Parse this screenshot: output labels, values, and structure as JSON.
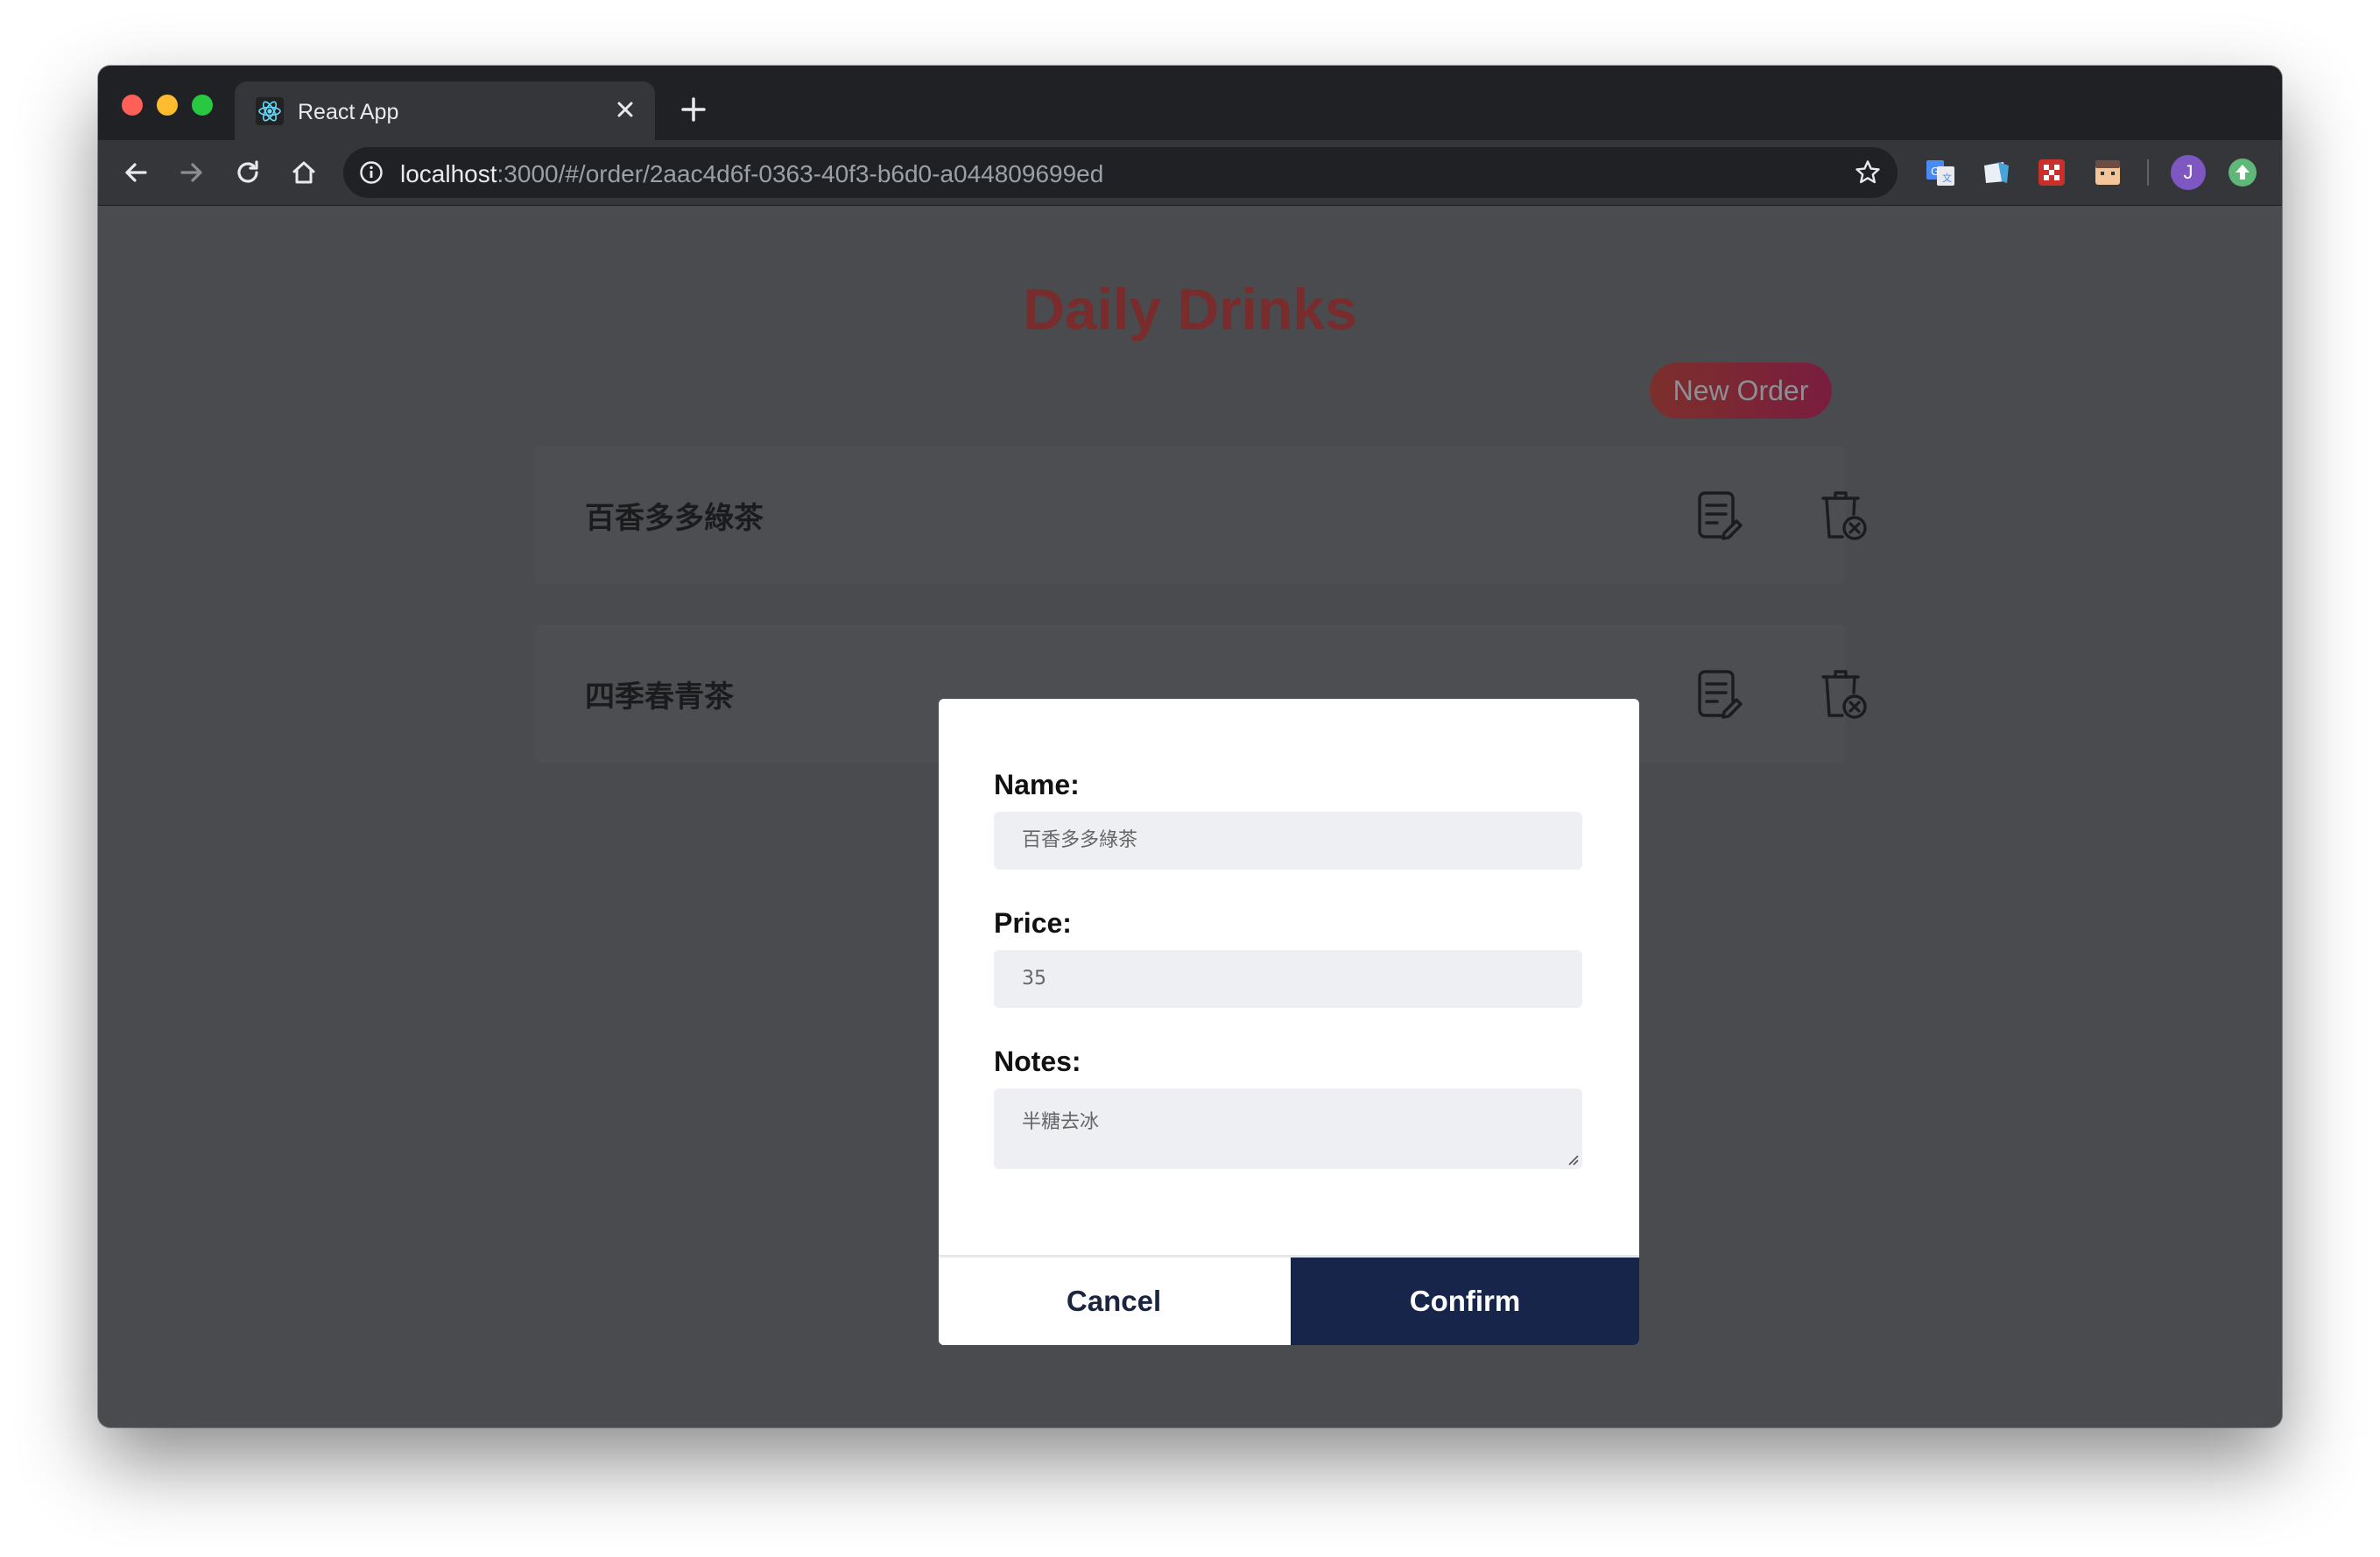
{
  "browser": {
    "tab_title": "React App",
    "url_host": "localhost",
    "url_path": ":3000/#/order/2aac4d6f-0363-40f3-b6d0-a044809699ed",
    "avatar_initial": "J"
  },
  "page": {
    "title": "Daily Drinks",
    "new_order_label": "New Order",
    "orders": [
      {
        "name": "百香多多綠茶"
      },
      {
        "name": "四季春青茶"
      }
    ]
  },
  "modal": {
    "name_label": "Name:",
    "name_value": "百香多多綠茶",
    "price_label": "Price:",
    "price_value": "35",
    "notes_label": "Notes:",
    "notes_value": "半糖去冰",
    "cancel_label": "Cancel",
    "confirm_label": "Confirm"
  },
  "colors": {
    "title": "#7a2b2b",
    "confirm_bg": "#18254a",
    "overlay_bg": "#4a4b4e",
    "input_bg": "#eeeff2"
  },
  "icons": {
    "favicon": "react-icon",
    "row_edit": "edit-document-icon",
    "row_delete": "delete-trash-icon"
  }
}
